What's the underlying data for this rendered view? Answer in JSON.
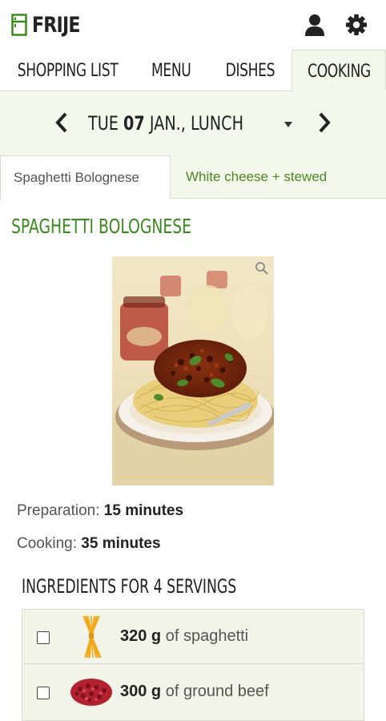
{
  "app": {
    "title": "FRIJE"
  },
  "header": {
    "user_icon": "user-icon",
    "settings_icon": "gear-icon"
  },
  "tabs": [
    {
      "label": "SHOPPING LIST"
    },
    {
      "label": "MENU"
    },
    {
      "label": "DISHES"
    },
    {
      "label": "COOKING",
      "active": true
    }
  ],
  "datebar": {
    "day_name": "TUE",
    "day_num": "07",
    "month": "JAN.,",
    "meal": "LUNCH",
    "prev_icon": "chevron-left-icon",
    "next_icon": "chevron-right-icon",
    "dropdown_icon": "caret-down-icon"
  },
  "dish_tabs": [
    {
      "label": "Spaghetti Bolognese",
      "active": true
    },
    {
      "label": "White cheese + stewed",
      "active": false
    }
  ],
  "recipe": {
    "title": "SPAGHETTI BOLOGNESE",
    "prep_label": "Preparation:",
    "prep_value": "15 minutes",
    "cook_label": "Cooking:",
    "cook_value": "35 minutes",
    "ingredients_title": "INGREDIENTS FOR 4 SERVINGS",
    "ingredients": [
      {
        "qty": "320 g",
        "text": "of spaghetti",
        "icon": "spaghetti-icon"
      },
      {
        "qty": "300 g",
        "text": "of ground beef",
        "icon": "ground-beef-icon"
      }
    ]
  },
  "colors": {
    "accent_green": "#3a8a1c",
    "panel_bg": "#f4f7ec",
    "border": "#d7dccc"
  }
}
